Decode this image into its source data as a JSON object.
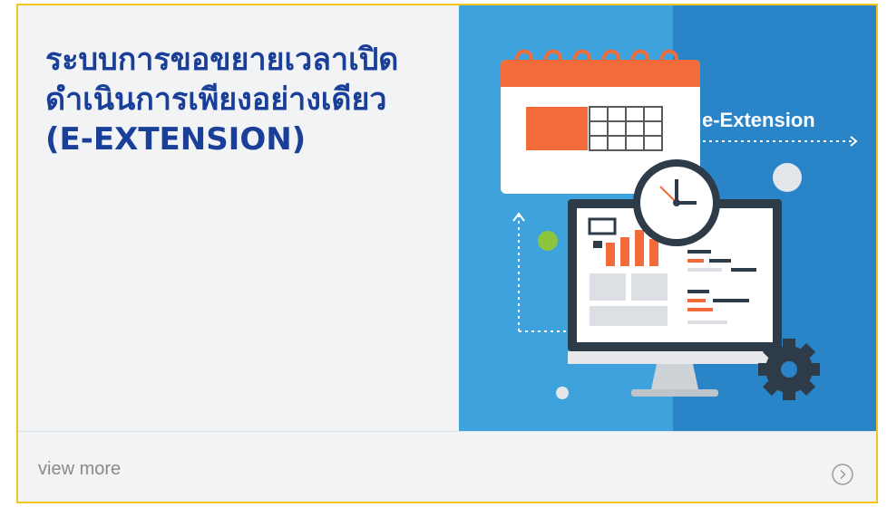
{
  "card": {
    "title_lines": [
      "ระบบการขอขยายเวลาเปิด",
      "ดำเนินการเพียงอย่างเดียว",
      "(E-EXTENSION)"
    ],
    "illustration_label": "e-Extension",
    "view_more_label": "view more",
    "arrow_icon": "chevron-right-circle-icon"
  },
  "colors": {
    "border": "#f5c518",
    "title": "#1a3f98",
    "illustration_bg_light": "#3ea3dc",
    "illustration_bg_dark": "#2a84c8",
    "accent_orange": "#f26b3a"
  }
}
